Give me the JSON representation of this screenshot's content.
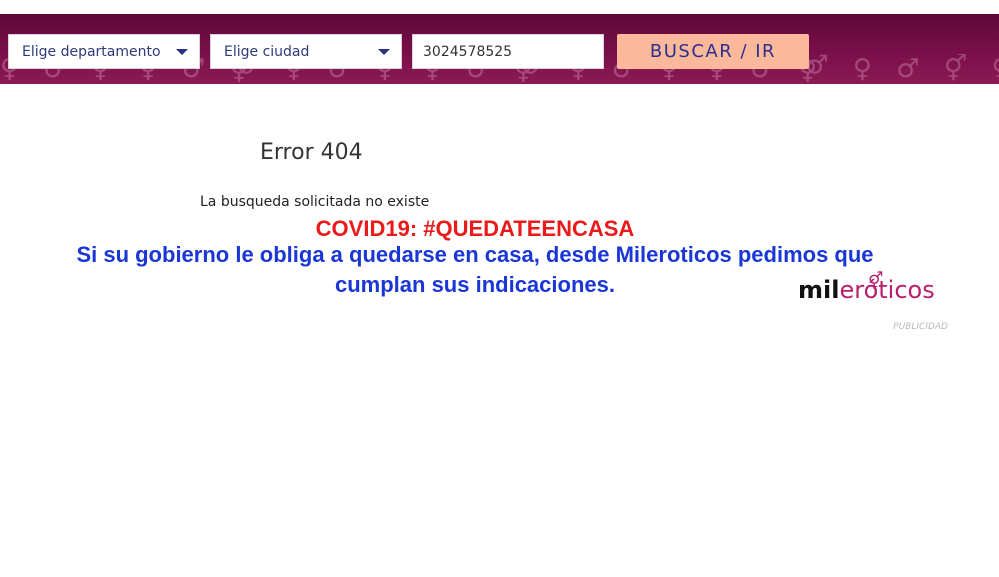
{
  "header": {
    "department_select": "Elige departamento",
    "city_select": "Elige ciudad",
    "search_value": "3024578525",
    "button_label": "BUSCAR / IR"
  },
  "error": {
    "title": "Error 404",
    "description": "La busqueda solicitada no existe"
  },
  "covid": {
    "heading": "COVID19: #QUEDATEENCASA",
    "message": "Si su gobierno le obliga a quedarse en casa, desde Mileroticos pedimos que cumplan sus indicaciones."
  },
  "ad": {
    "logo_part1": "mil",
    "logo_part2": "eróticos",
    "label": "PUBLICIDAD"
  },
  "colors": {
    "header_bg": "#7a0f4a",
    "button_bg": "#fbb89a",
    "button_text": "#2b2f8f",
    "covid_red": "#ea1a1a",
    "notice_blue": "#1b36d6",
    "brand_pink": "#b81f6a"
  },
  "icons": {
    "select_caret": "caret-down-icon",
    "header_pattern": "gender-symbols-pattern",
    "logo_symbol": "gender-symbol-icon"
  }
}
